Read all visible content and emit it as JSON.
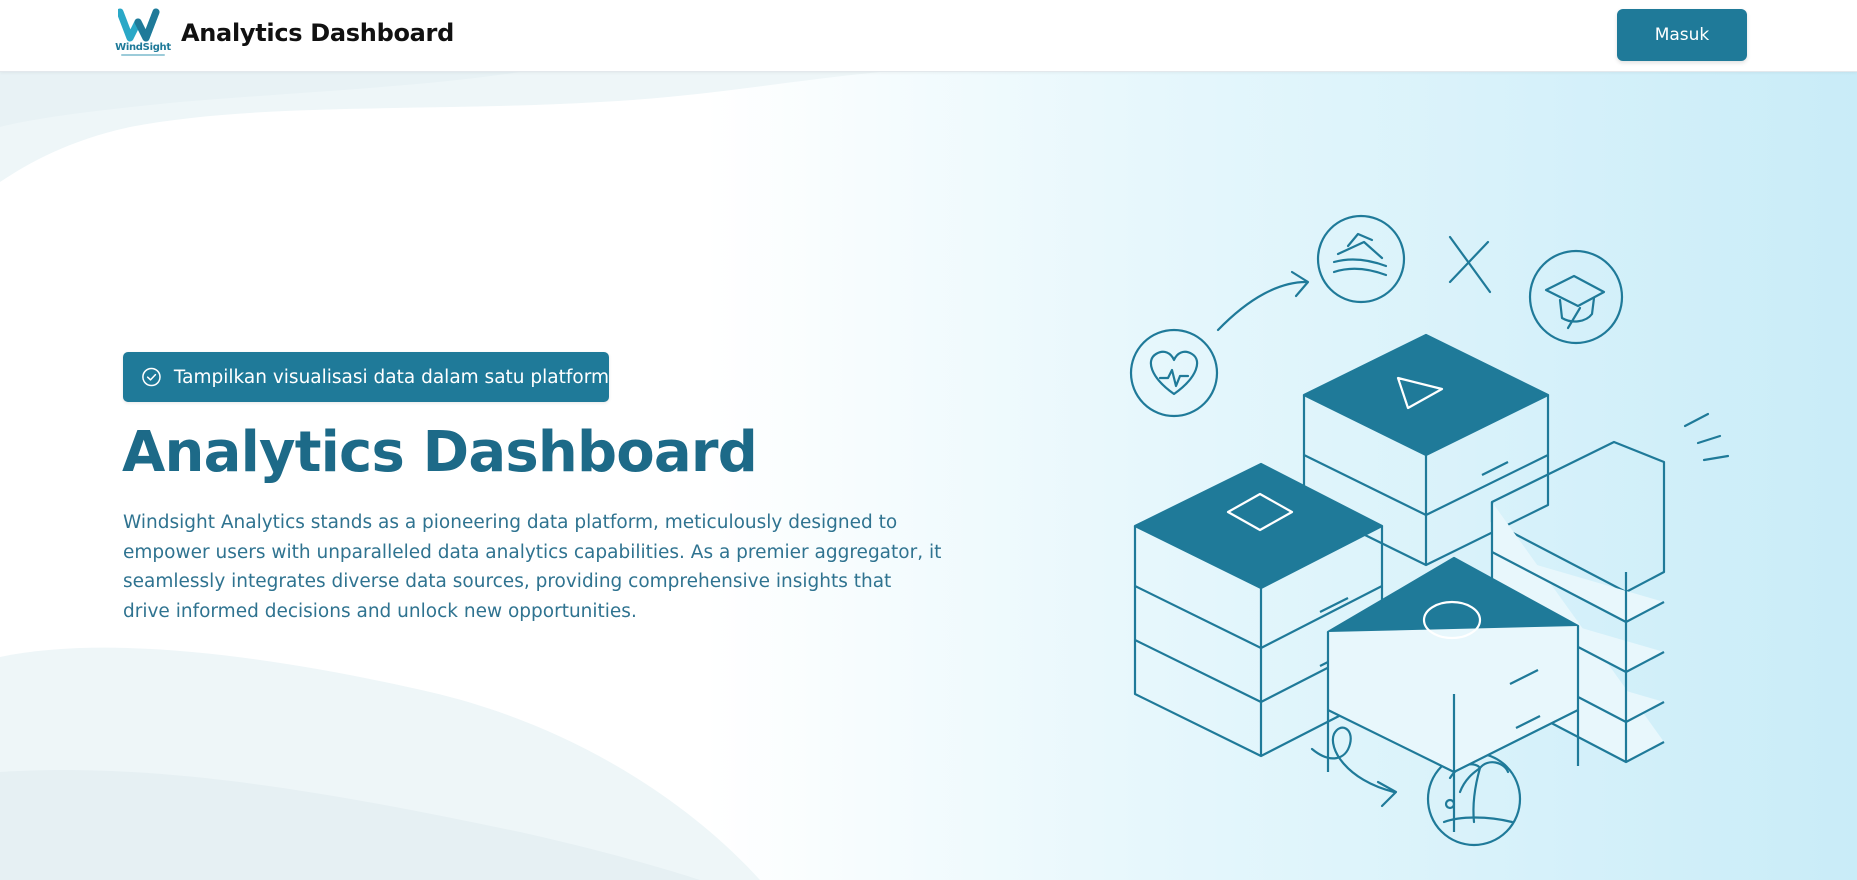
{
  "navbar": {
    "logo_text": "WindSight",
    "title": "Analytics Dashboard",
    "login_label": "Masuk"
  },
  "hero": {
    "badge_text": "Tampilkan visualisasi data dalam satu platform",
    "title": "Analytics Dashboard",
    "description": "Windsight Analytics stands as a pioneering data platform, meticulously designed to empower users with unparalleled data analytics capabilities. As a premier aggregator, it seamlessly integrates diverse data sources, providing comprehensive insights that drive informed decisions and unlock new opportunities."
  },
  "icons": {
    "badge": "check-circle-icon",
    "illustration": [
      "heart-pulse-icon",
      "layers-icon",
      "graduation-cap-icon",
      "palm-tree-icon",
      "cross-mark-icon",
      "arrow-icon"
    ]
  },
  "colors": {
    "primary": "#1f7a99",
    "title": "#1d6a88",
    "text": "#2f7390",
    "hero_gradient_end": "#c9ecf8"
  }
}
